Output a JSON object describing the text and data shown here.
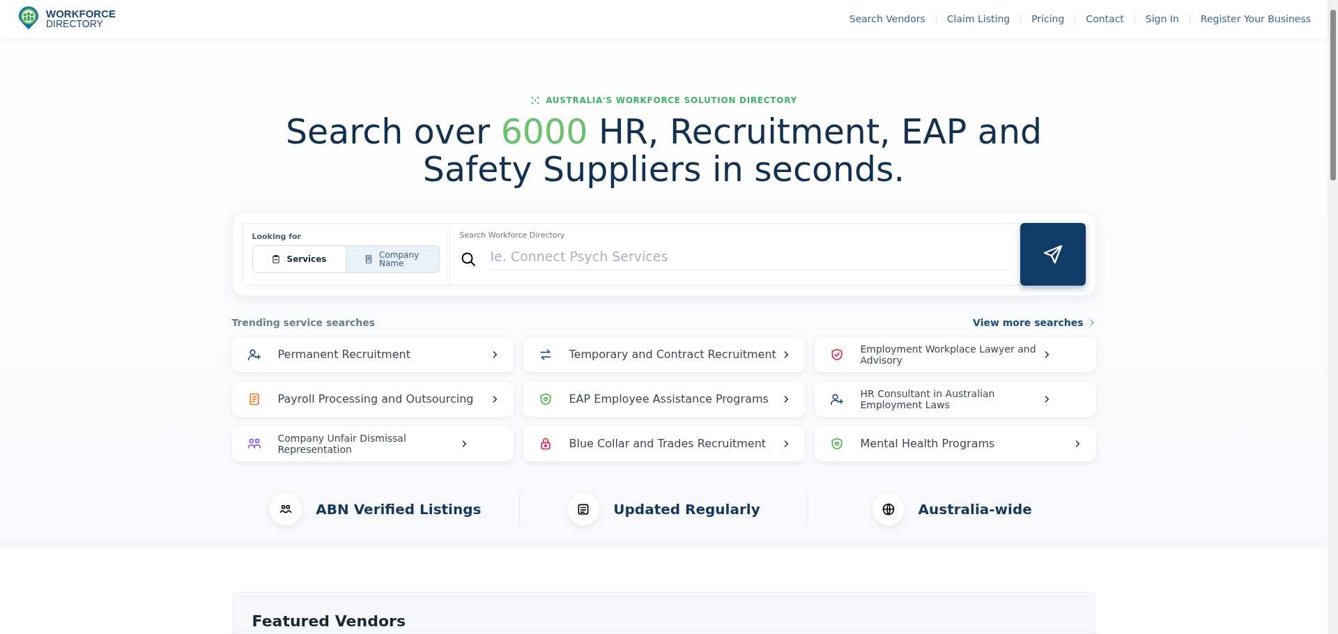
{
  "logo": {
    "line_1": "WORKFORCE",
    "line_2": "DIRECTORY"
  },
  "nav": [
    "Search Vendors",
    "Claim Listing",
    "Pricing",
    "Contact",
    "Sign In",
    "Register Your Business"
  ],
  "hero": {
    "eyebrow": "AUSTRALIA'S WORKFORCE SOLUTION DIRECTORY",
    "headline_before": "Search over",
    "headline_highlight": "6000",
    "headline_after": "HR, Recruitment, EAP and Safety Suppliers in seconds."
  },
  "search": {
    "looking_for_label": "Looking for",
    "options": [
      {
        "label": "Services",
        "selected": true
      },
      {
        "label": "Company Name",
        "selected": false
      }
    ],
    "field_label": "Search Workforce Directory",
    "placeholder": "Ie. Connect Psych Services"
  },
  "trending": {
    "title": "Trending service searches",
    "more_link": "View more searches",
    "items": [
      {
        "label": "Permanent Recruitment",
        "kind": "regular",
        "color": "#1f4e79"
      },
      {
        "label": "Temporary and Contract Recruitment",
        "kind": "regular",
        "color": "#1f4e79"
      },
      {
        "label": "Employment Workplace Lawyer and Advisory",
        "kind": "compact",
        "color": "#e11d48"
      },
      {
        "label": "Payroll Processing and Outsourcing",
        "kind": "regular",
        "color": "#f97316"
      },
      {
        "label": "EAP Employee Assistance Programs",
        "kind": "regular",
        "color": "#4caf50"
      },
      {
        "label": "HR Consultant in Australian Employment Laws",
        "kind": "compact",
        "color": "#1f4e79"
      },
      {
        "label": "Company Unfair Dismissal Representation",
        "kind": "compact",
        "color": "#8b5cf6"
      },
      {
        "label": "Blue Collar and Trades Recruitment",
        "kind": "regular",
        "color": "#e11d48"
      },
      {
        "label": "Mental Health Programs",
        "kind": "regular",
        "color": "#4caf50"
      }
    ]
  },
  "features": [
    "ABN Verified Listings",
    "Updated Regularly",
    "Australia-wide"
  ],
  "featured_vendors": {
    "title": "Featured Vendors"
  }
}
